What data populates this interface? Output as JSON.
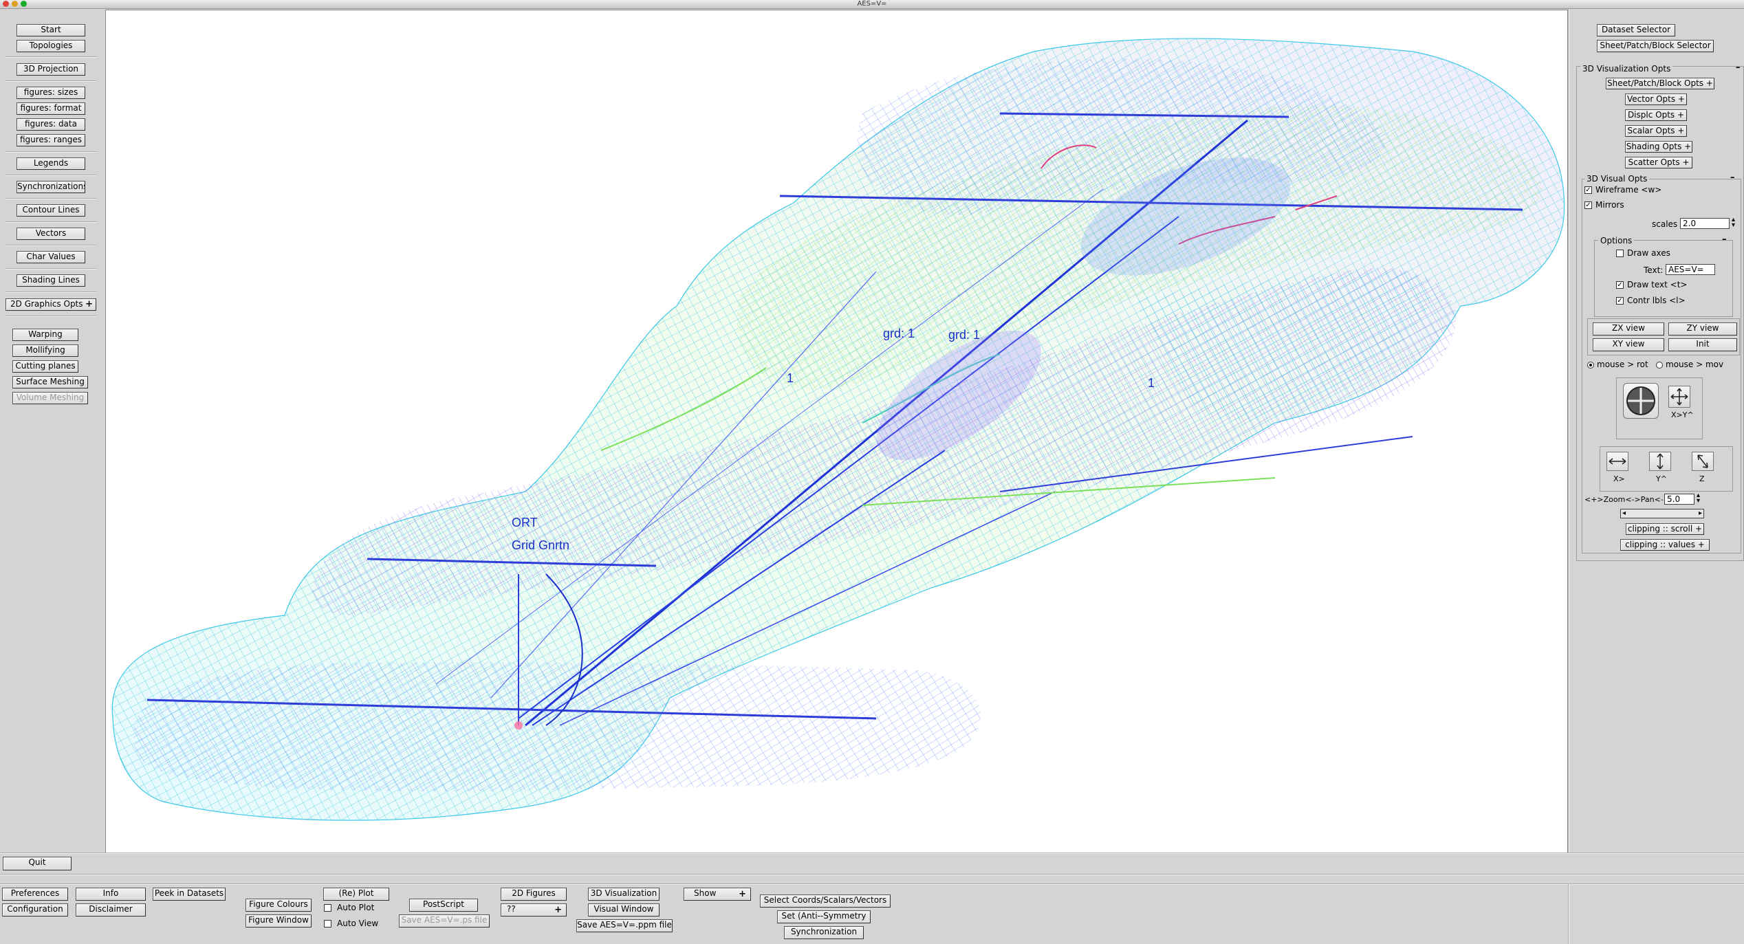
{
  "window": {
    "title": "AES=V="
  },
  "left_panel": {
    "buttons": [
      "Start",
      "Topologies",
      "3D Projection",
      "figures: sizes",
      "figures: format",
      "figures: data",
      "figures: ranges",
      "Legends",
      "Synchronizations",
      "Contour Lines",
      "Vectors",
      "Char Values",
      "Shading Lines"
    ],
    "graphics_opts": "2D Graphics Opts",
    "tools": [
      "Warping",
      "Mollifying",
      "Cutting planes",
      "Surface Meshing",
      "Volume  Meshing"
    ]
  },
  "viewport": {
    "labels": {
      "grd1_a": "grd: 1",
      "grd1_b": "grd: 1",
      "one_a": "1",
      "one_b": "1",
      "ort": "ORT",
      "grid_gnrtn": "Grid Gnrtn"
    }
  },
  "right_panel": {
    "dataset_selector": "Dataset Selector",
    "sheet_selector": "Sheet/Patch/Block Selector",
    "vis_opts_title": "3D Visualization Opts",
    "sub_opts": [
      "Sheet/Patch/Block Opts",
      "Vector  Opts",
      "Displc  Opts",
      "Scalar  Opts",
      "Shading  Opts",
      "Scatter Opts"
    ],
    "visual_opts_title": "3D Visual Opts",
    "wireframe": "Wireframe <w>",
    "mirrors": "Mirrors",
    "scales_label": "scales",
    "scales_value": "2.0",
    "options_title": "Options",
    "draw_axes": "Draw axes",
    "text_label": "Text:",
    "text_value": "AES=V=",
    "draw_text": "Draw  text <t>",
    "contr_lbls": "Contr lbls <l>",
    "views": [
      "ZX view",
      "ZY view",
      "XY view",
      "Init"
    ],
    "mouse_rot": "mouse > rot",
    "mouse_mov": "mouse > mov",
    "xy_pan_label": "X>Y^",
    "axis_labels": [
      "X>",
      "Y^",
      "Z"
    ],
    "zoom_label": "<+>Zoom<->Pan<->",
    "zoom_value": "5.0",
    "clipping_scroll": "clipping :: scroll",
    "clipping_values": "clipping :: values"
  },
  "bottom": {
    "quit": "Quit",
    "preferences": "Preferences",
    "configuration": "Configuration",
    "info": "Info",
    "disclaimer": "Disclaimer",
    "peek": "Peek in Datasets",
    "figure_colours": "Figure Colours",
    "figure_window": "Figure Window",
    "replot": "(Re) Plot",
    "auto_plot": "Auto Plot",
    "auto_view": "Auto View",
    "postscript": "PostScript",
    "save_ps": "Save AES=V=.ps file",
    "figures_2d": "2D Figures",
    "figures_2d_value": "??",
    "visualization_3d": "3D Visualization",
    "visual_window": "Visual Window",
    "save_ppm": "Save AES=V=.ppm file",
    "show": "Show",
    "select_coords": "Select Coords/Scalars/Vectors",
    "set_anti": "Set    (Anti--Symmetry",
    "synchronization": "Synchronization"
  }
}
